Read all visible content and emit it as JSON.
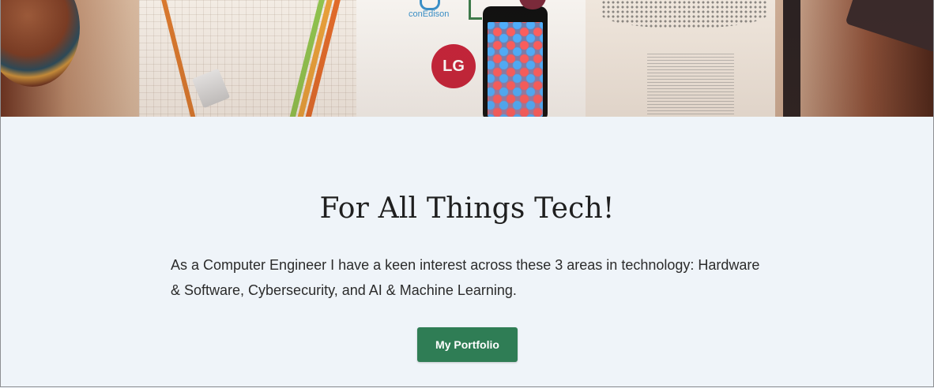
{
  "hero": {
    "brand_conedison": "conEdison",
    "brand_lg": "LG"
  },
  "main": {
    "title": "For All Things Tech!",
    "paragraph": "As a Computer Engineer I have a keen interest across these 3 areas in technology: Hardware & Software, Cybersecurity, and AI & Machine Learning.",
    "portfolio_button": "My Portfolio"
  },
  "colors": {
    "background": "#eff4f9",
    "button": "#2f7d55",
    "text": "#2b2b2b"
  },
  "icons": [
    "lg-logo-icon",
    "conedison-logo-icon",
    "smartphone-icon",
    "pencil-icon",
    "eraser-icon"
  ]
}
